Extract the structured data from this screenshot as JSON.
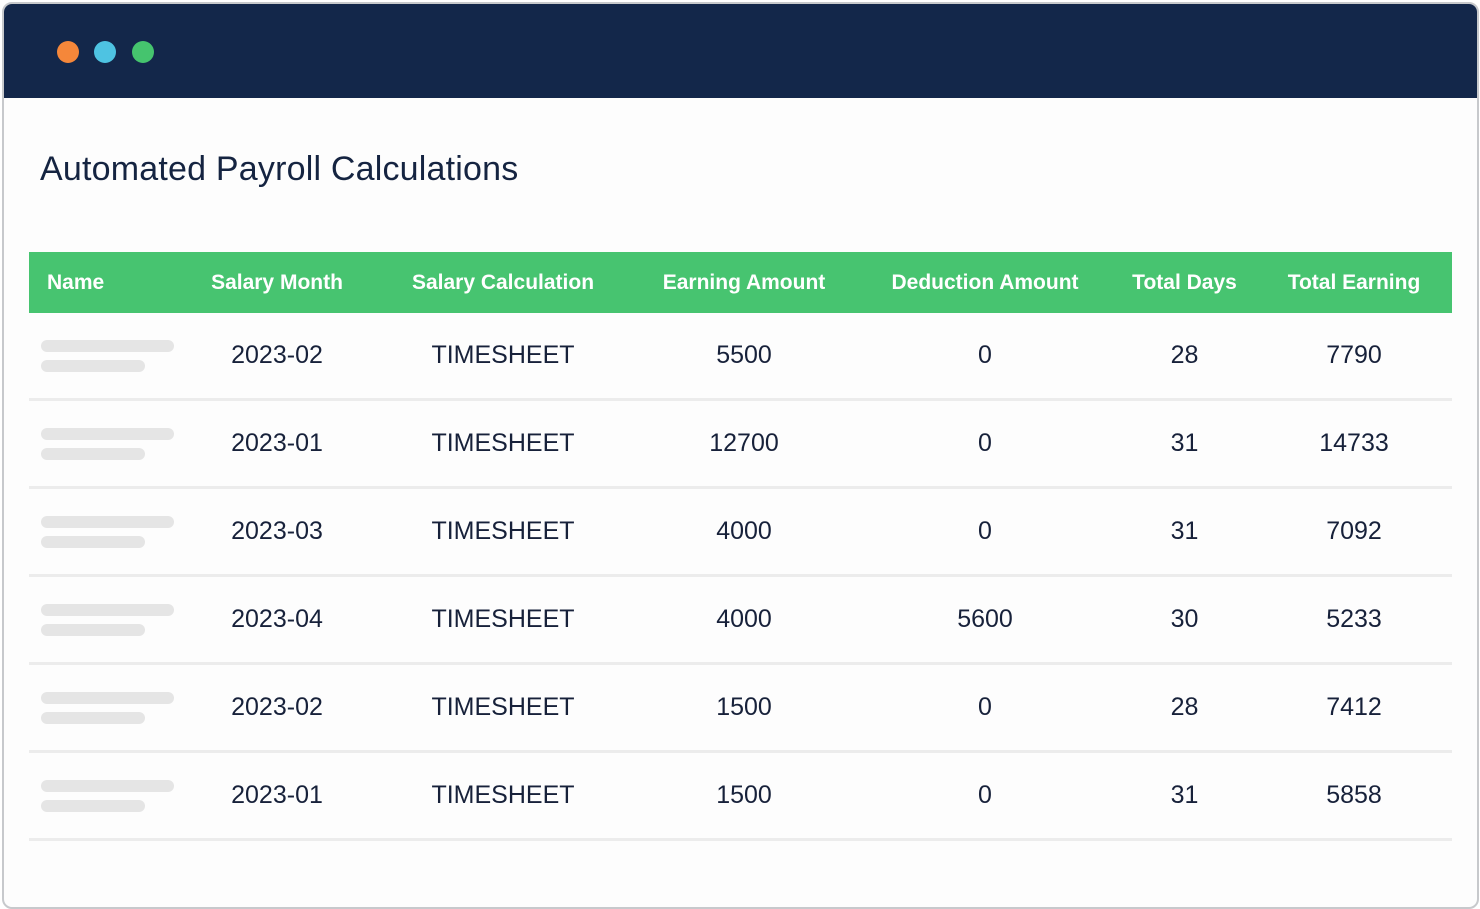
{
  "window": {
    "traffic_lights": [
      {
        "name": "close",
        "color": "#f5873a"
      },
      {
        "name": "minimize",
        "color": "#4ec3e2"
      },
      {
        "name": "maximize",
        "color": "#45c46e"
      }
    ]
  },
  "page": {
    "title": "Automated Payroll Calculations"
  },
  "table": {
    "columns": [
      "Name",
      "Salary Month",
      "Salary Calculation",
      "Earning Amount",
      "Deduction Amount",
      "Total Days",
      "Total Earning"
    ],
    "rows": [
      {
        "name": "",
        "salary_month": "2023-02",
        "salary_calculation": "TIMESHEET",
        "earning_amount": "5500",
        "deduction_amount": "0",
        "total_days": "28",
        "total_earning": "7790"
      },
      {
        "name": "",
        "salary_month": "2023-01",
        "salary_calculation": "TIMESHEET",
        "earning_amount": "12700",
        "deduction_amount": "0",
        "total_days": "31",
        "total_earning": "14733"
      },
      {
        "name": "",
        "salary_month": "2023-03",
        "salary_calculation": "TIMESHEET",
        "earning_amount": "4000",
        "deduction_amount": "0",
        "total_days": "31",
        "total_earning": "7092"
      },
      {
        "name": "",
        "salary_month": "2023-04",
        "salary_calculation": "TIMESHEET",
        "earning_amount": "4000",
        "deduction_amount": "5600",
        "total_days": "30",
        "total_earning": "5233"
      },
      {
        "name": "",
        "salary_month": "2023-02",
        "salary_calculation": "TIMESHEET",
        "earning_amount": "1500",
        "deduction_amount": "0",
        "total_days": "28",
        "total_earning": "7412"
      },
      {
        "name": "",
        "salary_month": "2023-01",
        "salary_calculation": "TIMESHEET",
        "earning_amount": "1500",
        "deduction_amount": "0",
        "total_days": "31",
        "total_earning": "5858"
      }
    ]
  },
  "colors": {
    "titlebar": "#13274a",
    "header_accent": "#47c470",
    "text": "#17213a"
  }
}
